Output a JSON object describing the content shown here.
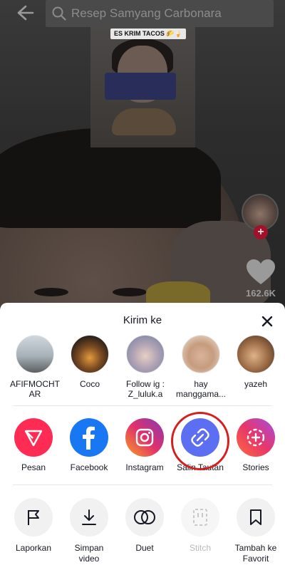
{
  "search": {
    "query": "Resep Samyang Carbonara"
  },
  "video": {
    "caption": "ES KRIM TACOS 🌮🍦"
  },
  "rail": {
    "like_count": "162.6K",
    "follow_symbol": "+"
  },
  "sheet": {
    "title": "Kirim ke",
    "contacts": [
      {
        "name_line1": "AFIFMOCHT",
        "name_line2": "AR"
      },
      {
        "name_line1": "Coco",
        "name_line2": ""
      },
      {
        "name_line1": "Follow ig :",
        "name_line2": "Z_luluk.a"
      },
      {
        "name_line1": "hay",
        "name_line2": "manggama..."
      },
      {
        "name_line1": "yazeh",
        "name_line2": ""
      }
    ],
    "share_targets": [
      {
        "label": "Pesan",
        "icon": "paper-plane-icon",
        "color": "#fe2c55"
      },
      {
        "label": "Facebook",
        "icon": "facebook-icon",
        "color": "#1877f2"
      },
      {
        "label": "Instagram",
        "icon": "instagram-icon",
        "color": "#dd2a7b"
      },
      {
        "label": "Salin Tautan",
        "icon": "link-icon",
        "color": "#5c6ff2"
      },
      {
        "label": "Stories",
        "icon": "stories-icon",
        "color": "#e7366b"
      }
    ],
    "actions": [
      {
        "label_line1": "Laporkan",
        "label_line2": "",
        "icon": "flag-icon"
      },
      {
        "label_line1": "Simpan",
        "label_line2": "video",
        "icon": "download-icon"
      },
      {
        "label_line1": "Duet",
        "label_line2": "",
        "icon": "duet-icon"
      },
      {
        "label_line1": "Stitch",
        "label_line2": "",
        "icon": "stitch-icon"
      },
      {
        "label_line1": "Tambah ke",
        "label_line2": "Favorit",
        "icon": "bookmark-icon"
      }
    ]
  }
}
